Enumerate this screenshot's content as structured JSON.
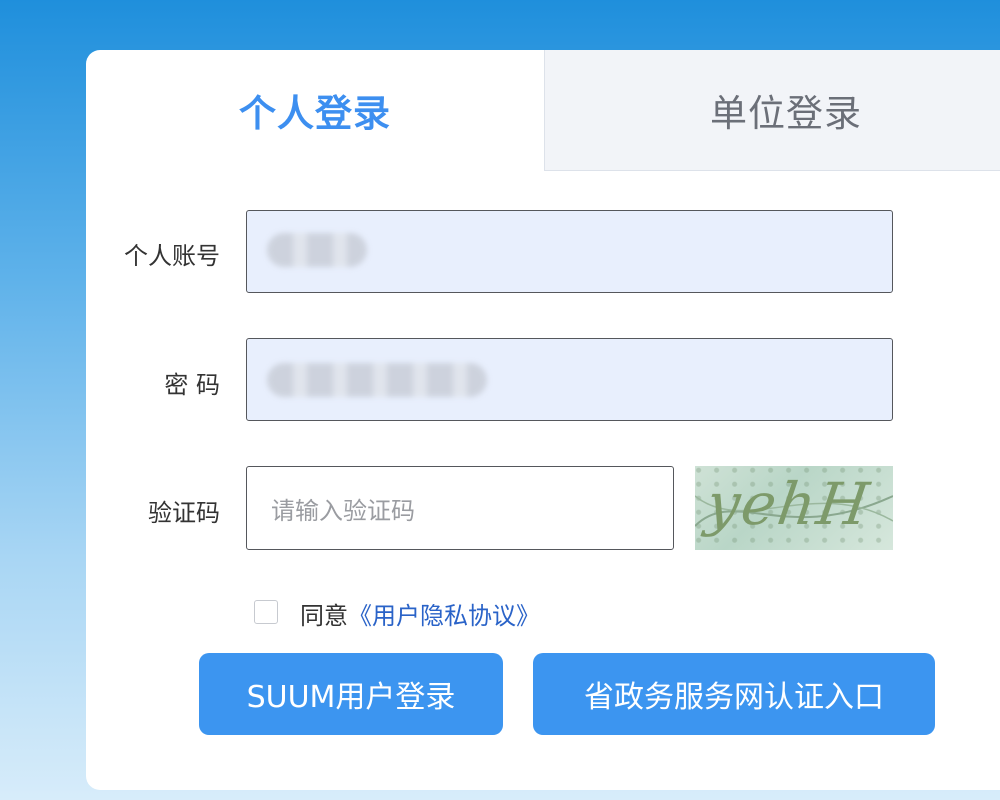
{
  "tabs": {
    "personal": "个人登录",
    "unit": "单位登录"
  },
  "form": {
    "account_label": "个人账号",
    "password_label": "密 码",
    "captcha_label": "验证码",
    "captcha_placeholder": "请输入验证码",
    "captcha_text": "yehH"
  },
  "agreement": {
    "prefix": "同意",
    "link": "《用户隐私协议》"
  },
  "buttons": {
    "suum_login": "SUUM用户登录",
    "gov_login": "省政务服务网认证入口"
  },
  "colors": {
    "accent": "#3c95f0",
    "active_tab": "#3d8ff0",
    "link": "#2a63c8",
    "filled_input_bg": "#e8effd"
  }
}
